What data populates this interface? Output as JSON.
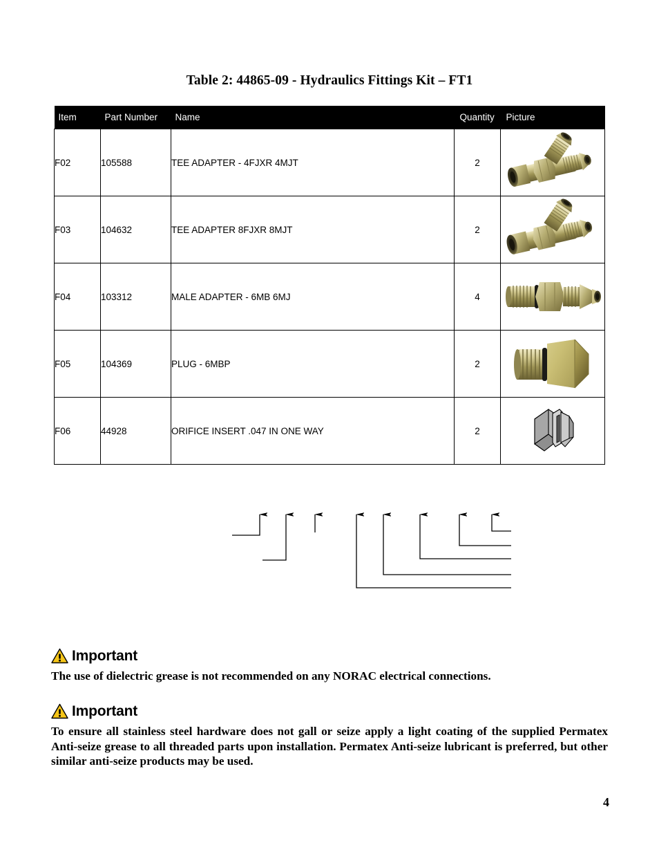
{
  "document": {
    "table_title": "Table 2: 44865-09 - Hydraulics Fittings Kit – FT1",
    "page_number": "4"
  },
  "table": {
    "headers": {
      "item": "Item",
      "part_number": "Part Number",
      "name": "Name",
      "quantity": "Quantity",
      "picture": "Picture"
    },
    "rows": [
      {
        "item": "F02",
        "part_number": "105588",
        "name": "TEE ADAPTER - 4FJXR 4MJT",
        "quantity": "2",
        "picture_kind": "tee-adapter-photo"
      },
      {
        "item": "F03",
        "part_number": "104632",
        "name": "TEE ADAPTER 8FJXR 8MJT",
        "quantity": "2",
        "picture_kind": "tee-adapter-photo"
      },
      {
        "item": "F04",
        "part_number": "103312",
        "name": "MALE ADAPTER -  6MB 6MJ",
        "quantity": "4",
        "picture_kind": "male-adapter-photo"
      },
      {
        "item": "F05",
        "part_number": "104369",
        "name": "PLUG - 6MBP",
        "quantity": "2",
        "picture_kind": "hex-plug-photo"
      },
      {
        "item": "F06",
        "part_number": "44928",
        "name": "ORIFICE INSERT .047 IN ONE WAY",
        "quantity": "2",
        "picture_kind": "orifice-insert-drawing"
      }
    ]
  },
  "callout_diagram": {
    "description": "unlabeled callout leader lines with arrowheads",
    "left_group_arrow_count": 3,
    "right_group_arrow_count": 5
  },
  "important_notices": [
    {
      "heading": "Important",
      "body": "The use of dielectric grease is not recommended on any NORAC electrical connections."
    },
    {
      "heading": "Important",
      "body": "To ensure all stainless steel hardware does not gall or seize apply a light coating of the supplied Permatex Anti-seize grease to all threaded parts upon installation. Permatex Anti-seize lubricant is preferred, but other similar anti-seize products may be used."
    }
  ],
  "colors": {
    "header_background": "#000000",
    "header_text": "#ffffff",
    "warning_triangle": "#f5c518",
    "page_background": "#ffffff",
    "metal_light": "#d8d2a8",
    "metal_mid": "#a89f63",
    "metal_dark": "#6f6a38",
    "drawing_gray": "#b5b5b5"
  }
}
